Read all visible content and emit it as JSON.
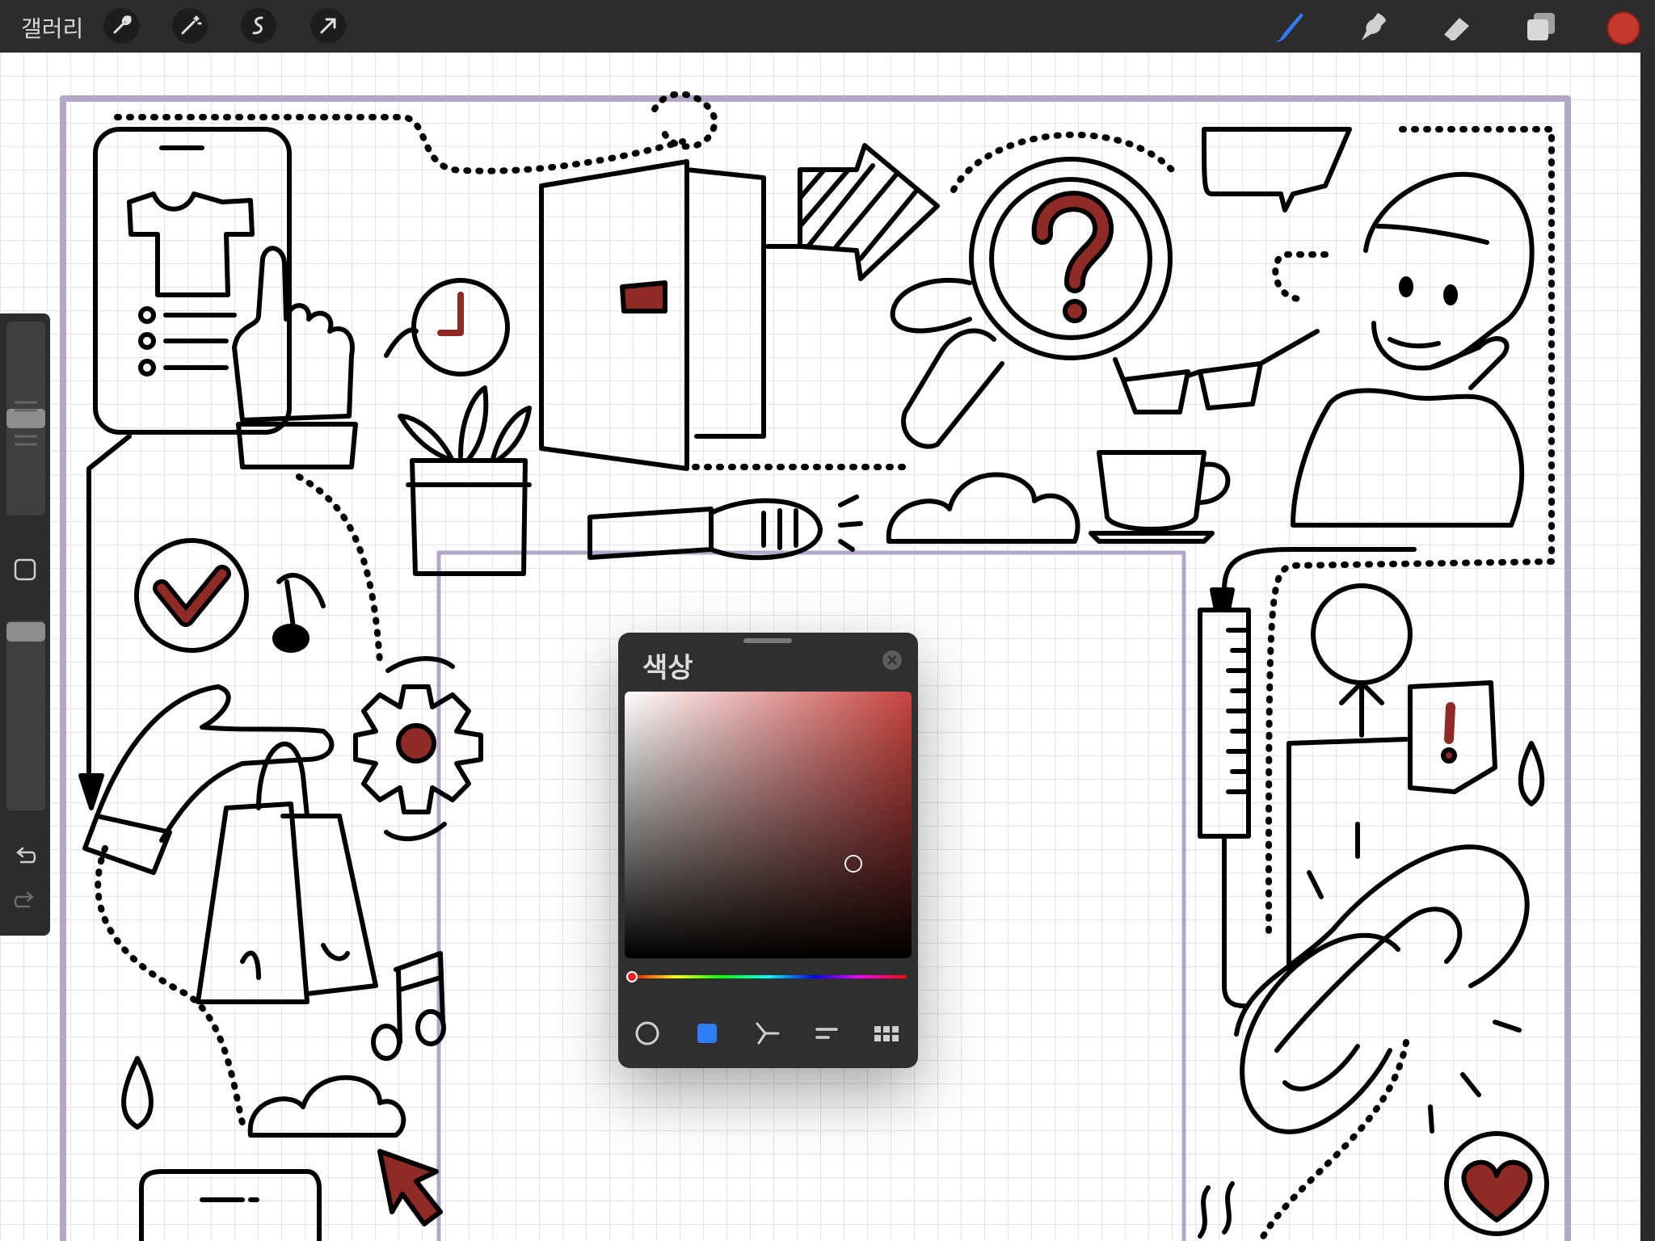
{
  "toolbar": {
    "gallery_label": "갤러리",
    "left_tools": [
      "wrench-icon",
      "magic-wand-icon",
      "selection-icon",
      "transform-arrow-icon"
    ],
    "right_tools": [
      "brush-icon",
      "smudge-icon",
      "eraser-icon",
      "layers-icon"
    ],
    "current_color": "#c4372b",
    "active_tool_color": "#2f7cf6"
  },
  "sidebar": {
    "brush_size_level": 0.37,
    "opacity_level": 1.0,
    "buttons": [
      "modify-square-icon",
      "undo-icon",
      "redo-icon"
    ]
  },
  "color_panel": {
    "title": "색상",
    "selected_color": "#7a2a28",
    "hue_color": "#c9443f",
    "tabs": [
      "disc-icon",
      "classic-icon",
      "harmony-icon",
      "value-icon",
      "palettes-icon"
    ],
    "active_tab": "classic-icon"
  },
  "canvas": {
    "accent_red": "#8e2b26",
    "guide_color": "#b4a6c8"
  }
}
